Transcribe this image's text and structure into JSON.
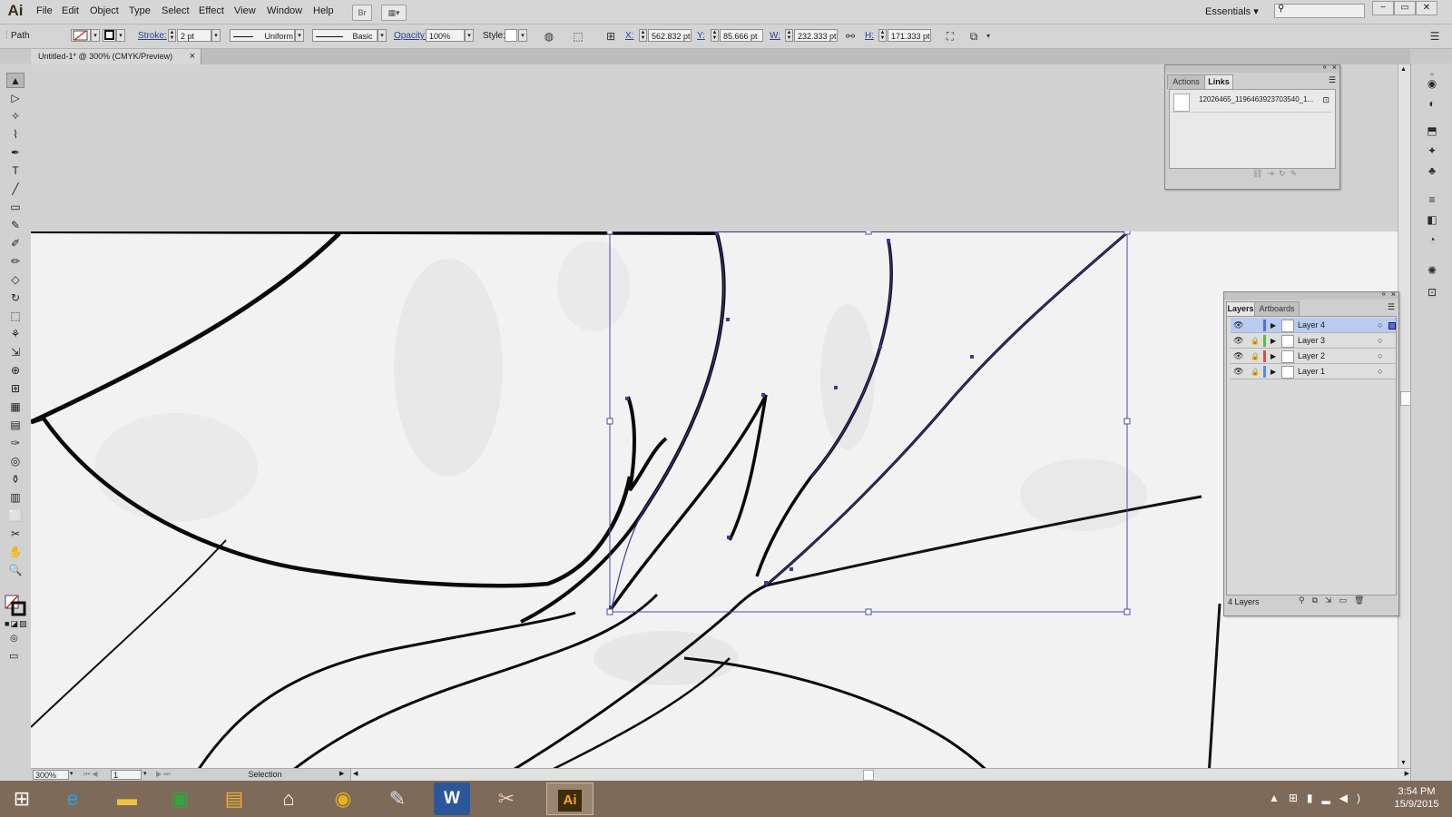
{
  "app": {
    "logo": "Ai"
  },
  "menu": {
    "items": [
      "File",
      "Edit",
      "Object",
      "Type",
      "Select",
      "Effect",
      "View",
      "Window",
      "Help"
    ]
  },
  "menubar_buttons": {
    "bridge": "Br",
    "arrange": "▦▾"
  },
  "workspace": {
    "label": "Essentials",
    "arrow": "▾"
  },
  "window_controls": {
    "minimize": "−",
    "restore": "▭",
    "close": "✕"
  },
  "control": {
    "selection_type": "Path",
    "stroke_label": "Stroke:",
    "stroke_weight": "2 pt",
    "profile": "Uniform",
    "brush": "Basic",
    "opacity_label": "Opacity:",
    "opacity": "100%",
    "style_label": "Style:",
    "x_label": "X:",
    "x": "562.832 pt",
    "y_label": "Y:",
    "y": "85.666 pt",
    "w_label": "W:",
    "w": "232.333 pt",
    "h_label": "H:",
    "h": "171.333 pt"
  },
  "document": {
    "tab_title": "Untitled-1* @ 300% (CMYK/Preview)",
    "close": "×"
  },
  "tools": [
    "▲",
    "▷",
    "✧",
    "⌇",
    "✒",
    "T",
    "╱",
    "▭",
    "✎",
    "✐",
    "✏",
    "◇",
    "↻",
    "⬚",
    "⚘",
    "⇲",
    "⊕",
    "⊞",
    "▦",
    "▤",
    "✑",
    "◎",
    "⚱",
    "▥",
    "⬜",
    "✂",
    "✋",
    "🔍"
  ],
  "dock": [
    "◉",
    "◐",
    "⬒",
    "✦",
    "♣",
    "≡",
    "◧",
    "◔",
    "✺",
    "⊡"
  ],
  "actions_links_panel": {
    "tabs": [
      "Actions",
      "Links"
    ],
    "active_tab": "Links",
    "link_file": "12026465_11964639237035​40_1..."
  },
  "layers_panel": {
    "tabs": [
      "Layers",
      "Artboards"
    ],
    "active_tab": "Layers",
    "layers": [
      {
        "name": "Layer 4",
        "color": "#4f6cf0",
        "locked": false,
        "selected": true
      },
      {
        "name": "Layer 3",
        "color": "#4fc04f",
        "locked": true,
        "selected": false
      },
      {
        "name": "Layer 2",
        "color": "#e04848",
        "locked": true,
        "selected": false
      },
      {
        "name": "Layer 1",
        "color": "#4f8cf0",
        "locked": true,
        "selected": false
      }
    ],
    "count": "4 Layers"
  },
  "status": {
    "zoom": "300%",
    "artboard": "1",
    "tool": "Selection"
  },
  "taskbar": {
    "apps": [
      "start-icon",
      "ie-icon",
      "explorer-icon",
      "store-icon",
      "notes-icon",
      "home-icon",
      "chrome-icon",
      "paint-icon",
      "word-icon",
      "snipping-icon",
      "illustrator-icon"
    ],
    "ai_label": "Ai",
    "word_label": "W",
    "time": "3:54 PM",
    "date": "15/9/2015"
  },
  "colors": {
    "selection": "#3a3aa0",
    "menubar": "#d6d6d6",
    "taskbar": "#7d6a58"
  }
}
